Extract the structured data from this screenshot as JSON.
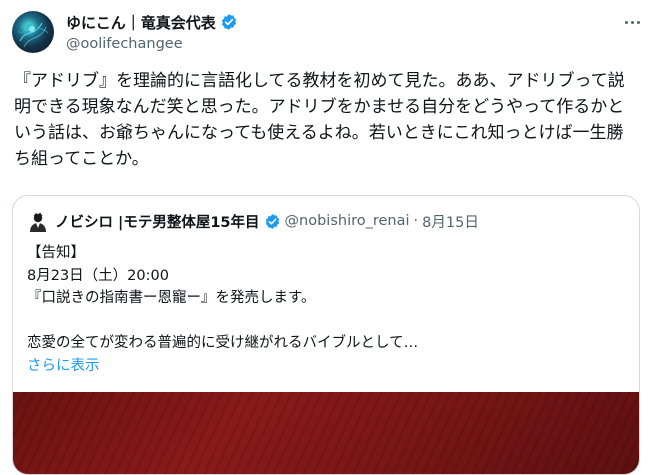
{
  "author": {
    "display_name": "ゆにこん｜竜真会代表",
    "handle": "@oolifechangee"
  },
  "tweet": {
    "text": "『アドリブ』を理論的に言語化してる教材を初めて見た。ああ、アドリブって説明できる現象なんだ笑と思った。アドリブをかませる自分をどうやって作るかという話は、お爺ちゃんになっても使えるよね。若いときにこれ知っとけば一生勝ち組ってことか。"
  },
  "quoted": {
    "display_name": "ノビシロ |モテ男整体屋15年目",
    "handle": "@nobishiro_renai",
    "separator": "·",
    "date": "8月15日",
    "lines": [
      "【告知】",
      "8月23日（土）20:00",
      "『口説きの指南書ー恩寵ー』を発売します。",
      "",
      " 恋愛の全てが変わる普遍的に受け継がれるバイブルとして…"
    ],
    "show_more": "さらに表示"
  },
  "icons": {
    "verified": "verified-badge-icon",
    "more": "more-options-icon"
  },
  "colors": {
    "verified": "#1d9bf0",
    "link": "#1d9bf0",
    "secondary_text": "#536471",
    "image_red": "#7a1515"
  }
}
